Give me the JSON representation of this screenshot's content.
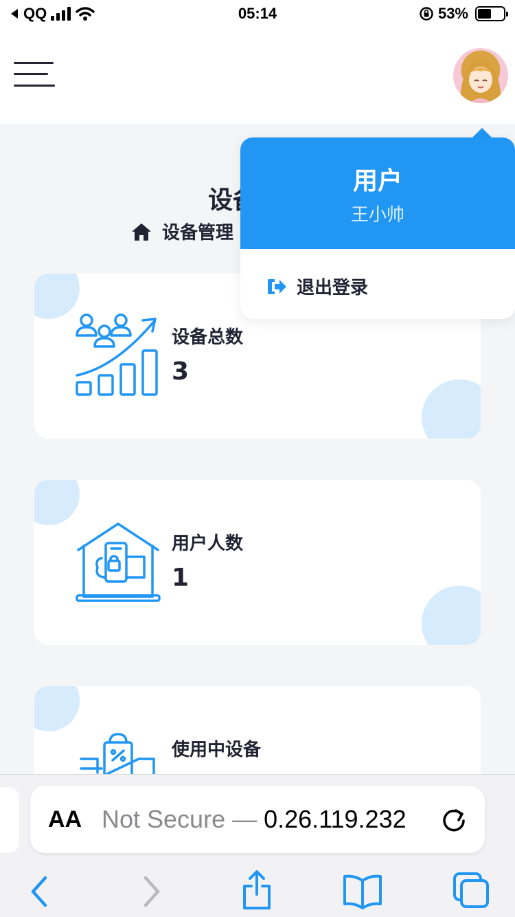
{
  "status_bar": {
    "carrier": "QQ",
    "time": "05:14",
    "battery": "53%",
    "battery_level": 0.53
  },
  "header": {
    "menu_icon": "hamburger-menu-icon",
    "avatar_icon": "user-avatar"
  },
  "page": {
    "title": "设备管理",
    "breadcrumb": "设备管理"
  },
  "cards": [
    {
      "label": "设备总数",
      "value": "3",
      "icon": "growth-chart-icon"
    },
    {
      "label": "用户人数",
      "value": "1",
      "icon": "smart-home-icon"
    },
    {
      "label": "使用中设备",
      "value": "",
      "icon": "shopping-bag-icon"
    }
  ],
  "dropdown": {
    "role": "用户",
    "name": "王小帅",
    "logout_label": "退出登录",
    "logout_icon": "sign-out-icon"
  },
  "safari": {
    "aa_label": "AA",
    "url_prefix": "Not Secure — ",
    "url_host": "0.26.119.232",
    "reload_icon": "reload-icon",
    "toolbar": [
      "back-icon",
      "forward-icon",
      "share-icon",
      "bookmarks-icon",
      "tabs-icon"
    ]
  },
  "colors": {
    "accent": "#2196f3",
    "blob": "#d6ecfc",
    "text": "#222233",
    "background": "#f4f5f7"
  }
}
